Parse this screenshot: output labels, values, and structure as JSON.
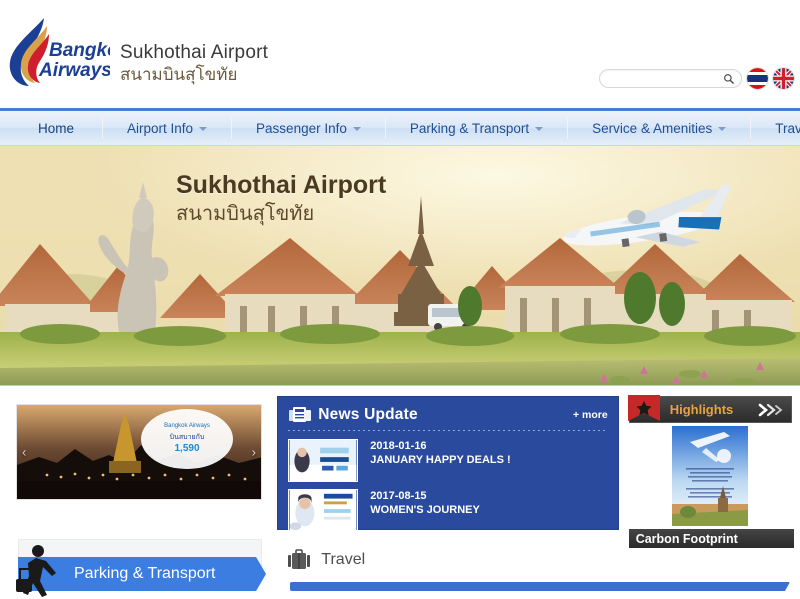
{
  "header": {
    "logo_alt": "Bangkok Airways",
    "logo_line1": "Bangkok",
    "logo_line2": "Airways",
    "title_en": "Sukhothai Airport",
    "title_th": "สนามบินสุโขทัย",
    "search": {
      "value": "",
      "placeholder": ""
    },
    "languages": [
      {
        "name": "thai-flag",
        "label": "TH"
      },
      {
        "name": "english-flag",
        "label": "EN"
      }
    ]
  },
  "nav": {
    "items": [
      {
        "label": "Home",
        "has_caret": false
      },
      {
        "label": "Airport Info",
        "has_caret": true
      },
      {
        "label": "Passenger Info",
        "has_caret": true
      },
      {
        "label": "Parking & Transport",
        "has_caret": true
      },
      {
        "label": "Service & Amenities",
        "has_caret": true
      },
      {
        "label": "Travel",
        "has_caret": true
      }
    ]
  },
  "hero": {
    "title_en": "Sukhothai Airport",
    "title_th": "สนามบินสุโขทัย"
  },
  "left": {
    "promo_alt": "Loi Krathong festival promotion",
    "promo_prev": "‹",
    "promo_next": "›",
    "parking_label": "Parking & Transport"
  },
  "news": {
    "title": "News Update",
    "more_label": "+ more",
    "items": [
      {
        "date": "2018-01-16",
        "headline": "JANUARY HAPPY DEALS !"
      },
      {
        "date": "2017-08-15",
        "headline": "WOMEN'S JOURNEY"
      }
    ]
  },
  "travel": {
    "label": "Travel"
  },
  "highlights": {
    "title": "Highlights",
    "next_label": "≫",
    "caption": "Carbon Footprint"
  },
  "colors": {
    "nav_blue": "#4a7fd0",
    "news_blue": "#2a4a9e",
    "accent_blue": "#3b7de0",
    "highlight_gold": "#e8a33d",
    "highlight_dark": "#3a3a3a",
    "ribbon_red": "#c62828"
  }
}
